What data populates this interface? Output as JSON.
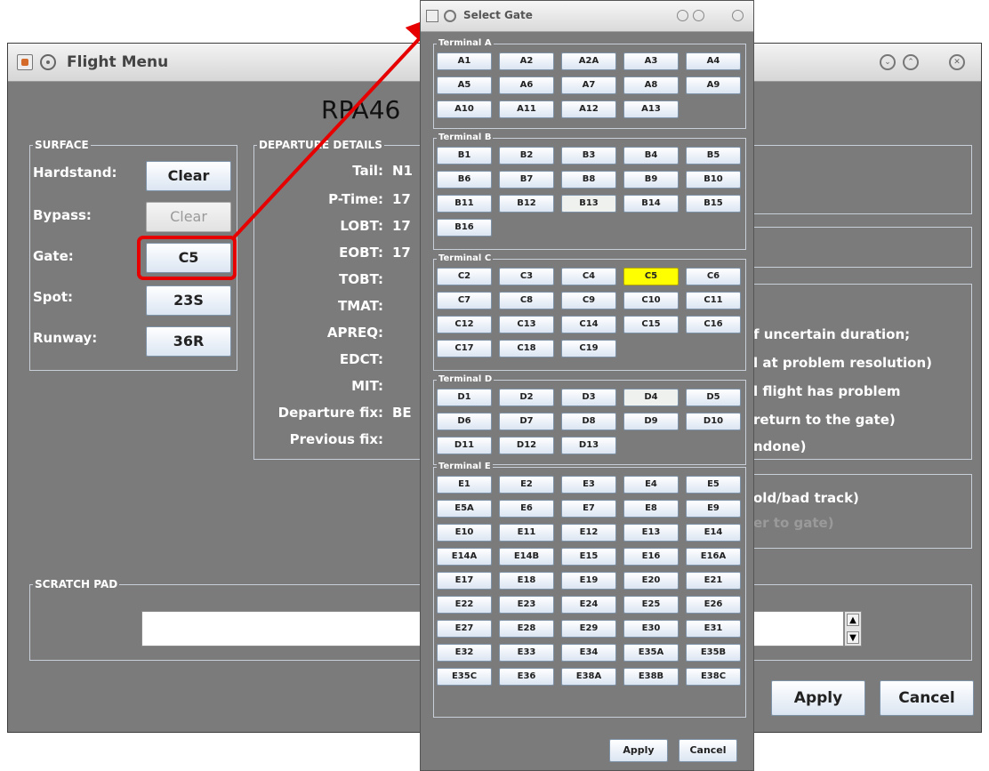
{
  "main": {
    "title": "Flight Menu",
    "callsign": "RPA46",
    "surface": {
      "title": "SURFACE",
      "rows": [
        {
          "label": "Hardstand:",
          "button": "Clear",
          "enabled": true
        },
        {
          "label": "Bypass:",
          "button": "Clear",
          "enabled": false
        },
        {
          "label": "Gate:",
          "button": "C5",
          "enabled": true
        },
        {
          "label": "Spot:",
          "button": "23S",
          "enabled": true
        },
        {
          "label": "Runway:",
          "button": "36R",
          "enabled": true
        }
      ]
    },
    "departure": {
      "title": "DEPARTURE DETAILS",
      "rows": [
        {
          "label": "Tail:",
          "value": "N1"
        },
        {
          "label": "P-Time:",
          "value": "17"
        },
        {
          "label": "LOBT:",
          "value": "17"
        },
        {
          "label": "EOBT:",
          "value": "17"
        },
        {
          "label": "TOBT:",
          "value": ""
        },
        {
          "label": "TMAT:",
          "value": ""
        },
        {
          "label": "APREQ:",
          "value": ""
        },
        {
          "label": "EDCT:",
          "value": ""
        },
        {
          "label": "MIT:",
          "value": ""
        },
        {
          "label": "Departure fix:",
          "value": "BE"
        },
        {
          "label": "Previous fix:",
          "value": ""
        }
      ]
    },
    "right_text": {
      "line1": "f uncertain duration;",
      "line2": "l at problem resolution)",
      "line3": "l flight has problem",
      "line4": "return to the gate)",
      "line5": "ndone)",
      "line6": "old/bad track)",
      "line7": "er to gate)"
    },
    "scratch": {
      "title": "SCRATCH PAD",
      "value": ""
    },
    "apply": "Apply",
    "cancel": "Cancel"
  },
  "dialog": {
    "title": "Select Gate",
    "selected_gate": "C5",
    "terminals": [
      {
        "name": "Terminal A",
        "gates": [
          "A1",
          "A2",
          "A2A",
          "A3",
          "A4",
          "A5",
          "A6",
          "A7",
          "A8",
          "A9",
          "A10",
          "A11",
          "A12",
          "A13"
        ]
      },
      {
        "name": "Terminal B",
        "gates": [
          "B1",
          "B2",
          "B3",
          "B4",
          "B5",
          "B6",
          "B7",
          "B8",
          "B9",
          "B10",
          "B11",
          "B12",
          "B13",
          "B14",
          "B15",
          "B16"
        ]
      },
      {
        "name": "Terminal C",
        "gates": [
          "C2",
          "C3",
          "C4",
          "C5",
          "C6",
          "C7",
          "C8",
          "C9",
          "C10",
          "C11",
          "C12",
          "C13",
          "C14",
          "C15",
          "C16",
          "C17",
          "C18",
          "C19"
        ]
      },
      {
        "name": "Terminal D",
        "gates": [
          "D1",
          "D2",
          "D3",
          "D4",
          "D5",
          "D6",
          "D7",
          "D8",
          "D9",
          "D10",
          "D11",
          "D12",
          "D13"
        ]
      },
      {
        "name": "Terminal E",
        "gates": [
          "E1",
          "E2",
          "E3",
          "E4",
          "E5",
          "E5A",
          "E6",
          "E7",
          "E8",
          "E9",
          "E10",
          "E11",
          "E12",
          "E13",
          "E14",
          "E14A",
          "E14B",
          "E15",
          "E16",
          "E16A",
          "E17",
          "E18",
          "E19",
          "E20",
          "E21",
          "E22",
          "E23",
          "E24",
          "E25",
          "E26",
          "E27",
          "E28",
          "E29",
          "E30",
          "E31",
          "E32",
          "E33",
          "E34",
          "E35A",
          "E35B",
          "E35C",
          "E36",
          "E38A",
          "E38B",
          "E38C"
        ]
      }
    ],
    "apply": "Apply",
    "cancel": "Cancel"
  },
  "colors": {
    "selected_gate": "#ffff00",
    "highlight": "#e60000",
    "panel": "#7b7b7b"
  }
}
